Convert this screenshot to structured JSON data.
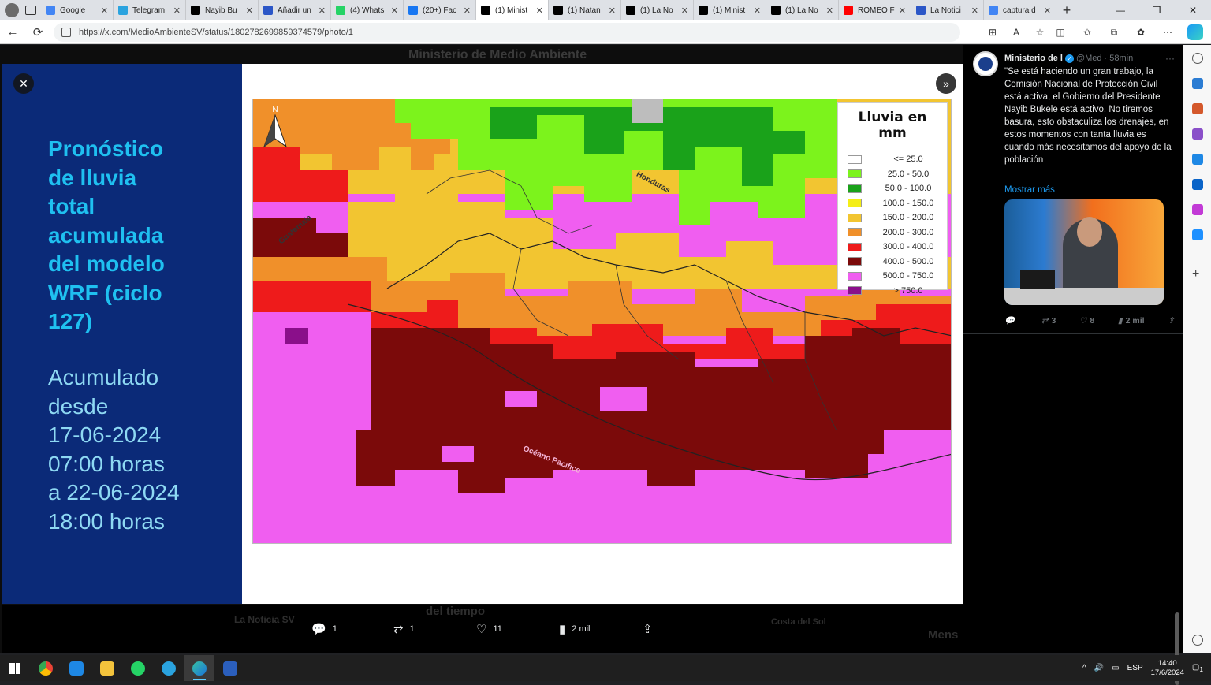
{
  "browser": {
    "tabs": [
      {
        "title": "Google",
        "icon": "google-icon",
        "color": "#4285f4"
      },
      {
        "title": "Telegram",
        "icon": "telegram-icon",
        "color": "#2aa3df"
      },
      {
        "title": "Nayib Bu",
        "icon": "x-icon",
        "color": "#000000"
      },
      {
        "title": "Añadir un",
        "icon": "n-icon",
        "color": "#2b56c7"
      },
      {
        "title": "(4) Whats",
        "icon": "whatsapp-icon",
        "color": "#25d366"
      },
      {
        "title": "(20+) Fac",
        "icon": "facebook-icon",
        "color": "#1877f2"
      },
      {
        "title": "(1) Minist",
        "icon": "x-icon",
        "color": "#000000",
        "active": true
      },
      {
        "title": "(1) Natan",
        "icon": "x-icon",
        "color": "#000000"
      },
      {
        "title": "(1) La No",
        "icon": "x-icon",
        "color": "#000000"
      },
      {
        "title": "(1) Minist",
        "icon": "x-icon",
        "color": "#000000"
      },
      {
        "title": "(1) La No",
        "icon": "x-icon",
        "color": "#000000"
      },
      {
        "title": "ROMEO F",
        "icon": "youtube-icon",
        "color": "#ff0000"
      },
      {
        "title": "La Notici",
        "icon": "n-icon",
        "color": "#2b56c7"
      },
      {
        "title": "captura d",
        "icon": "google-icon",
        "color": "#4285f4"
      }
    ],
    "url": "https://x.com/MedioAmbienteSV/status/1802782699859374579/photo/1"
  },
  "photo": {
    "title": "Pronóstico\nde lluvia\ntotal\nacumulada\ndel modelo\nWRF (ciclo\n127)",
    "subtitle": "Acumulado\ndesde\n17-06-2024\n07:00 horas\na 22-06-2024\n18:00 horas",
    "map": {
      "legend_title": "Lluvia en mm",
      "legend": [
        {
          "label": "<= 25.0",
          "color": "#ffffff"
        },
        {
          "label": "25.0 - 50.0",
          "color": "#7cf31c"
        },
        {
          "label": "50.0 - 100.0",
          "color": "#1aa21a"
        },
        {
          "label": "100.0 - 150.0",
          "color": "#f4ee17"
        },
        {
          "label": "150.0 - 200.0",
          "color": "#f2c531"
        },
        {
          "label": "200.0 - 300.0",
          "color": "#f0902a"
        },
        {
          "label": "300.0 - 400.0",
          "color": "#ee1b1b"
        },
        {
          "label": "400.0 - 500.0",
          "color": "#7b0a0a"
        },
        {
          "label": "500.0 - 750.0",
          "color": "#f05ef0"
        },
        {
          "label": "> 750.0",
          "color": "#8a0f8a"
        }
      ],
      "labels": {
        "honduras": "Honduras",
        "guatemala": "Guatemala",
        "ocean": "Océano Pacífico",
        "north": "N"
      }
    }
  },
  "tweet_actions": {
    "replies": "1",
    "reposts": "1",
    "likes": "11",
    "views": "2 mil"
  },
  "side_tweet": {
    "name": "Ministerio de l",
    "handle": "@Med",
    "time": "· 58min",
    "body": "\"Se está haciendo un gran trabajo, la Comisión Nacional de Protección Civil está activa, el Gobierno del Presidente Nayib Bukele está activo. No tiremos basura, esto obstaculiza los drenajes, en estos momentos con tanta lluvia es cuando más necesitamos del apoyo de la población",
    "show_more": "Mostrar más",
    "stats": {
      "replies": "",
      "reposts": "3",
      "likes": "8",
      "views": "2 mil"
    }
  },
  "background": {
    "header": "Ministerio de Medio Ambiente",
    "label1": "del tiempo",
    "label2": "La Noticia SV",
    "label3": "Costa del Sol",
    "label4": "Mens"
  },
  "taskbar": {
    "lang": "ESP",
    "time": "14:40",
    "date": "17/6/2024",
    "notif": "1"
  }
}
